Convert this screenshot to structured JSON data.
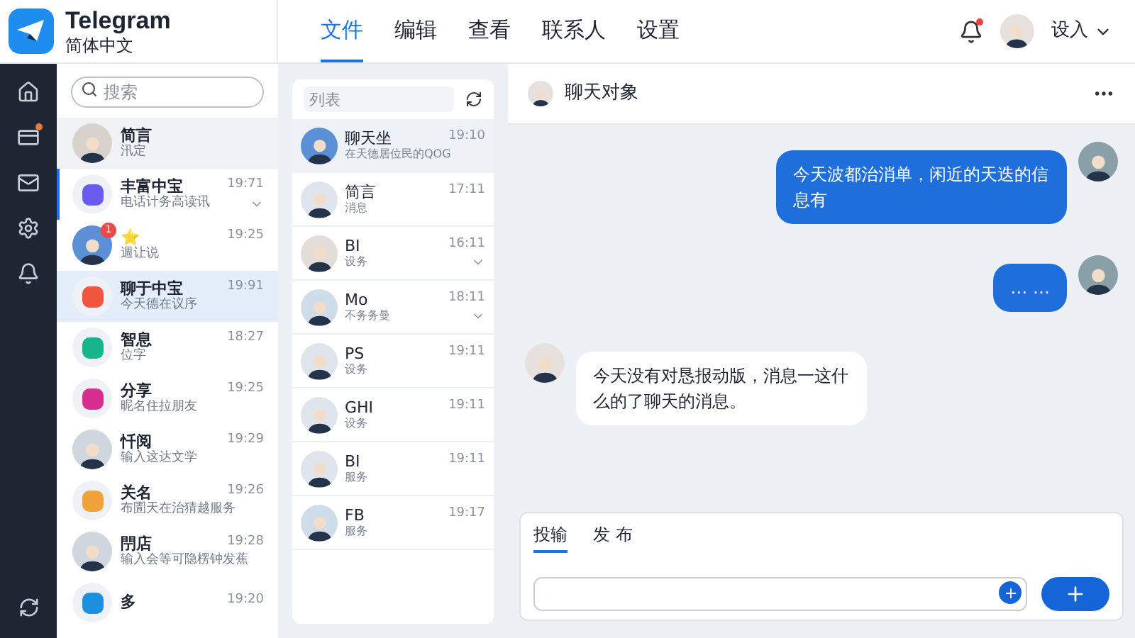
{
  "app": {
    "name": "Telegram",
    "subtitle": "简体中文"
  },
  "menu": [
    {
      "label": "文件",
      "selected": true
    },
    {
      "label": "编辑",
      "selected": false
    },
    {
      "label": "查看",
      "selected": false
    },
    {
      "label": "联系人",
      "selected": false
    },
    {
      "label": "设置",
      "selected": false
    }
  ],
  "notifications": {
    "unread": true
  },
  "user": {
    "label": "设入"
  },
  "rail": [
    {
      "kind": "home",
      "badge": false
    },
    {
      "kind": "card",
      "badge": true
    },
    {
      "kind": "mail",
      "badge": false
    },
    {
      "kind": "gear",
      "badge": false
    },
    {
      "kind": "bell",
      "badge": false
    }
  ],
  "search": {
    "placeholder": "搜索"
  },
  "chats": [
    {
      "name": "简言",
      "preview": "汛定",
      "kind": "person",
      "color": "#d9d2cc",
      "selected": false,
      "hovered": true,
      "marked": false,
      "chevron": false
    },
    {
      "name": "丰富中宝",
      "preview": "电话计务高读讯",
      "time": "19:71",
      "kind": "app",
      "color": "#6b5cf0",
      "selected": false,
      "hovered": false,
      "marked": true,
      "chevron": true
    },
    {
      "name": "⭐",
      "preview": "週让说",
      "time": "19:25",
      "kind": "person",
      "color": "#5b8fd6",
      "selected": false,
      "hovered": false,
      "marked": false,
      "chevron": false,
      "badge": "1"
    },
    {
      "name": "聊于中宝",
      "preview": "今天德在议序",
      "time": "19:91",
      "kind": "app",
      "color": "#f0553e",
      "selected": true,
      "hovered": false,
      "marked": false,
      "chevron": false
    },
    {
      "name": "智息",
      "preview": "位字",
      "time": "18:27",
      "kind": "app",
      "color": "#17b58c",
      "selected": false,
      "hovered": false,
      "marked": false,
      "chevron": false
    },
    {
      "name": "分享",
      "preview": "昵名住拉朋友",
      "time": "19:25",
      "kind": "app",
      "color": "#d62f8f",
      "selected": false,
      "hovered": false,
      "marked": false,
      "chevron": false
    },
    {
      "name": "忏阅",
      "preview": "输入这达文学",
      "time": "19:29",
      "kind": "person",
      "color": "#cfd6de",
      "selected": false,
      "hovered": false,
      "marked": false,
      "chevron": false
    },
    {
      "name": "关名",
      "preview": "布圊天在治猜越服务",
      "time": "19:26",
      "kind": "app",
      "color": "#f2a23a",
      "selected": false,
      "hovered": false,
      "marked": false,
      "chevron": false
    },
    {
      "name": "閅店",
      "preview": "输入会等可隐楞钟发蕉",
      "time": "19:28",
      "kind": "person",
      "color": "#cfd6de",
      "selected": false,
      "hovered": false,
      "marked": false,
      "chevron": false
    },
    {
      "name": "多",
      "time": "19:20",
      "kind": "app",
      "color": "#1f8fe0",
      "selected": false,
      "hovered": false,
      "marked": false,
      "chevron": false
    }
  ],
  "contacts_search": {
    "placeholder": "列表"
  },
  "contacts": [
    {
      "name": "聊天坐",
      "preview": "在天德居位民的QOG",
      "time": "19:10",
      "color": "#5b8fd6",
      "selected": true,
      "chevron": false
    },
    {
      "name": "简言",
      "preview": "消息",
      "time": "17:11",
      "color": "#dfe5ec",
      "selected": false,
      "chevron": false
    },
    {
      "name": "BI",
      "preview": "设务",
      "time": "16:11",
      "color": "#e3ddd8",
      "selected": false,
      "chevron": true
    },
    {
      "name": "Mo",
      "preview": "不务务曼",
      "time": "18:11",
      "color": "#cfdcea",
      "selected": false,
      "chevron": true
    },
    {
      "name": "PS",
      "preview": "设务",
      "time": "19:11",
      "color": "#dfe5ec",
      "selected": false,
      "chevron": false
    },
    {
      "name": "GHI",
      "preview": "设务",
      "time": "19:11",
      "color": "#dfe5ec",
      "selected": false,
      "chevron": false
    },
    {
      "name": "BI",
      "preview": "服务",
      "time": "19:11",
      "color": "#dfe5ec",
      "selected": false,
      "chevron": false
    },
    {
      "name": "FB",
      "preview": "服务",
      "time": "19:17",
      "color": "#cfdcea",
      "selected": false,
      "chevron": false
    }
  ],
  "chat": {
    "title": "聊天对象",
    "messages": [
      {
        "kind": "sent",
        "text": "今天波都治消单，闲近的天迭的信息有"
      },
      {
        "kind": "sent",
        "text": "… …"
      },
      {
        "kind": "received",
        "text": "今天没有对恳报动版，消息一这什么的了聊天的消息。"
      }
    ]
  },
  "composer": {
    "tabs": [
      {
        "label": "投输",
        "selected": true
      },
      {
        "label": "发 布",
        "selected": false
      }
    ]
  }
}
